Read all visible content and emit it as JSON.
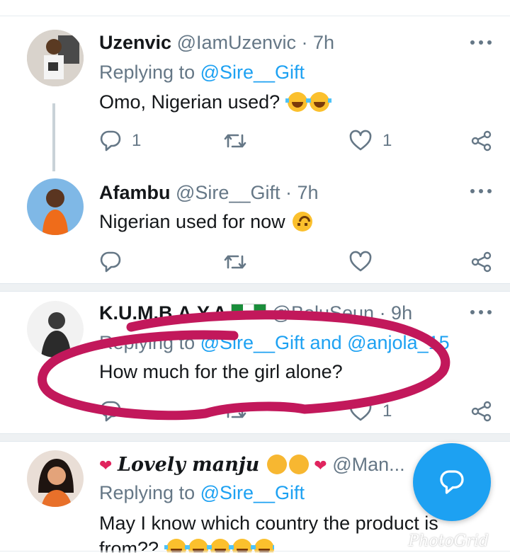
{
  "tweets": [
    {
      "name": "Uzenvic",
      "handle": "@IamUzenvic",
      "time": "· 7h",
      "replying_prefix": "Replying to ",
      "replying_to": "@Sire__Gift",
      "text": "Omo, Nigerian used?",
      "emoji": "face-with-tears-of-joy-emoji ×2",
      "reply_count": "1",
      "like_count": "1"
    },
    {
      "name": "Afambu",
      "handle": "@Sire__Gift",
      "time": "· 7h",
      "text": "Nigerian used for now",
      "emoji": "upside-down-face-emoji"
    },
    {
      "name": "K.U.M.B.A.Y.A",
      "handle": "@BoluSeun",
      "time": "· 9h",
      "replying_prefix": "Replying to ",
      "replying_to": "@Sire__Gift and @anjola_15",
      "text": "How much for the girl alone?",
      "like_count": "1",
      "annotation_color": "#c2185b"
    },
    {
      "name": "Lovely manju",
      "handle": "@Man...",
      "replying_prefix": "Replying to ",
      "replying_to": "@Sire__Gift",
      "text": "May I know which country the product is",
      "text2": "from??"
    }
  ],
  "fab": {
    "icon": "compose-reply-icon",
    "color": "#1da1f2"
  },
  "watermark": "PhotoGrid",
  "colors": {
    "link": "#1da1f2",
    "secondary": "#657786",
    "annotation": "#c2185b"
  }
}
